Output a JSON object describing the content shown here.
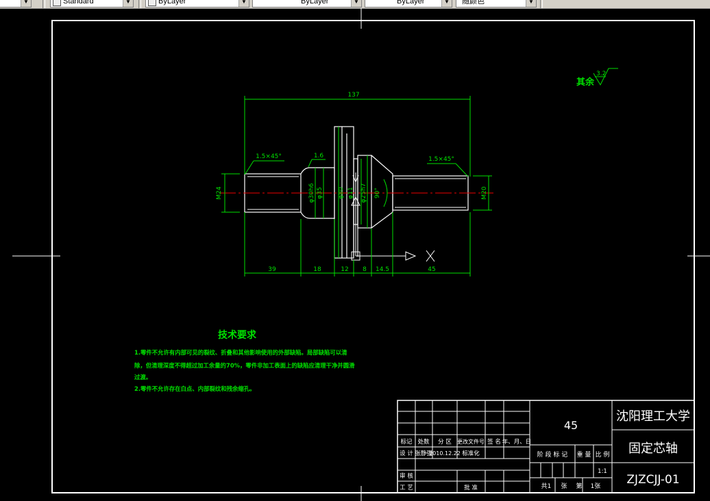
{
  "toolbar": {
    "text_style": "Standard",
    "layer": "ByLayer",
    "linetype": "ByLayer",
    "lineweight": "ByLayer",
    "plot_style": "随颜色"
  },
  "drawing": {
    "roughness_note_label": "其余",
    "roughness_value": "3.2",
    "dims": {
      "overall_length": "137",
      "chamfer_left": "1.5×45°",
      "chamfer_small": "1.6",
      "chamfer_right": "1.5×45°",
      "thread_left": "M24",
      "shaft_fit": "φ30h6",
      "shaft_d1": "φ35",
      "flange_d": "φ80",
      "bore_d": "φ11",
      "cone_d": "φ25h7",
      "cone_angle": "90°",
      "thread_right": "M20",
      "len_1": "39",
      "len_2": "18",
      "len_3": "12",
      "len_4": "8",
      "len_5": "14.5",
      "len_6": "45"
    },
    "tech_req_title": "技术要求",
    "tech_req_lines": [
      "1.零件不允许有内部可见的裂纹、折叠和其他影响使用的外部缺陷。局部缺陷可以清",
      "除，但清理深度不得超过加工余量的70%，零件非加工表面上的缺陷应清理干净并圆滑",
      "过渡。",
      "2.零件不允许存在白点、内部裂纹和残余缩孔。"
    ]
  },
  "title_block": {
    "material": "45",
    "university": "沈阳理工大学",
    "part_name": "固定芯轴",
    "drawing_no": "ZJZCJJ-01",
    "row_mark": [
      "标记",
      "处数",
      "分 区",
      "更改文件号",
      "签 名",
      "年、月、日"
    ],
    "row_design": [
      "设 计",
      "张静强",
      "2010.12.22",
      "标准化"
    ],
    "stage_label": "阶 段 标 记",
    "weight_label": "重 量",
    "scale_label": "比 例",
    "scale_value": "1:1",
    "review_label": "审 核",
    "process_label": "工 艺",
    "approve_label": "批 准",
    "sheet_total_a": "共1",
    "sheet_total_b": "张",
    "sheet_no_a": "第",
    "sheet_no_b": "1张"
  }
}
